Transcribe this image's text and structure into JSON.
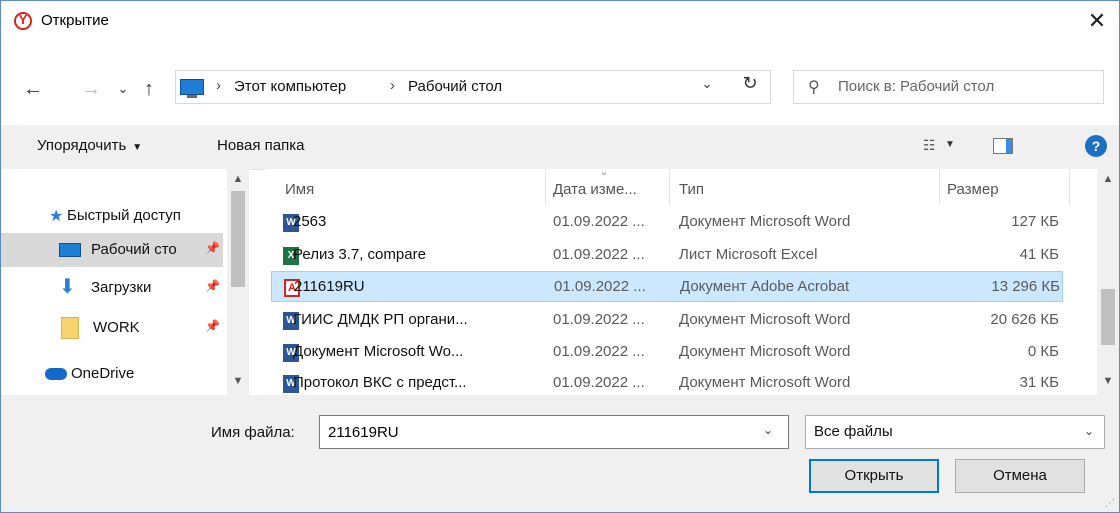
{
  "window": {
    "title": "Открытие",
    "close_glyph": "✕",
    "app_icon": "yandex-browser-logo"
  },
  "nav": {
    "back": "←",
    "forward": "→",
    "recent": "⌄",
    "up": "↑",
    "breadcrumb": [
      "Этот компьютер",
      "Рабочий стол"
    ],
    "separator": "›",
    "refresh": "↻",
    "search_placeholder": "Поиск в: Рабочий стол"
  },
  "toolbar": {
    "organize": "Упорядочить",
    "new_folder": "Новая папка",
    "help": "?"
  },
  "sidebar": {
    "items": [
      {
        "label": "Быстрый доступ",
        "icon": "star-icon",
        "selected": false,
        "pinned": false
      },
      {
        "label": "Рабочий сто",
        "icon": "desktop-icon",
        "selected": true,
        "pinned": true
      },
      {
        "label": "Загрузки",
        "icon": "download-icon",
        "selected": false,
        "pinned": true
      },
      {
        "label": "WORK",
        "icon": "folder-icon",
        "selected": false,
        "pinned": true
      },
      {
        "label": "OneDrive",
        "icon": "cloud-icon",
        "selected": false,
        "pinned": false
      }
    ]
  },
  "columns": {
    "name": "Имя",
    "date": "Дата изме...",
    "type": "Тип",
    "size": "Размер"
  },
  "files": [
    {
      "name": "2563",
      "date": "01.09.2022 ...",
      "type": "Документ Microsoft Word",
      "size": "127 КБ",
      "icon": "word",
      "selected": false
    },
    {
      "name": "Релиз 3.7, compare",
      "date": "01.09.2022 ...",
      "type": "Лист Microsoft Excel",
      "size": "41 КБ",
      "icon": "excel",
      "selected": false
    },
    {
      "name": "211619RU",
      "date": "01.09.2022 ...",
      "type": "Документ Adobe Acrobat",
      "size": "13 296 КБ",
      "icon": "pdf",
      "selected": true
    },
    {
      "name": "ГИИС ДМДК РП органи...",
      "date": "01.09.2022 ...",
      "type": "Документ Microsoft Word",
      "size": "20 626 КБ",
      "icon": "word",
      "selected": false
    },
    {
      "name": "Документ Microsoft Wo...",
      "date": "01.09.2022 ...",
      "type": "Документ Microsoft Word",
      "size": "0 КБ",
      "icon": "word",
      "selected": false
    },
    {
      "name": "Протокол ВКС с предст...",
      "date": "01.09.2022 ...",
      "type": "Документ Microsoft Word",
      "size": "31 КБ",
      "icon": "word",
      "selected": false
    }
  ],
  "footer": {
    "filename_label": "Имя файла:",
    "filename_value": "211619RU",
    "filter": "Все файлы",
    "open": "Открыть",
    "cancel": "Отмена"
  },
  "colors": {
    "accent": "#0078d7",
    "selection": "#cce8ff",
    "word": "#2b5797",
    "excel": "#1f7244",
    "pdf": "#d4231e"
  }
}
